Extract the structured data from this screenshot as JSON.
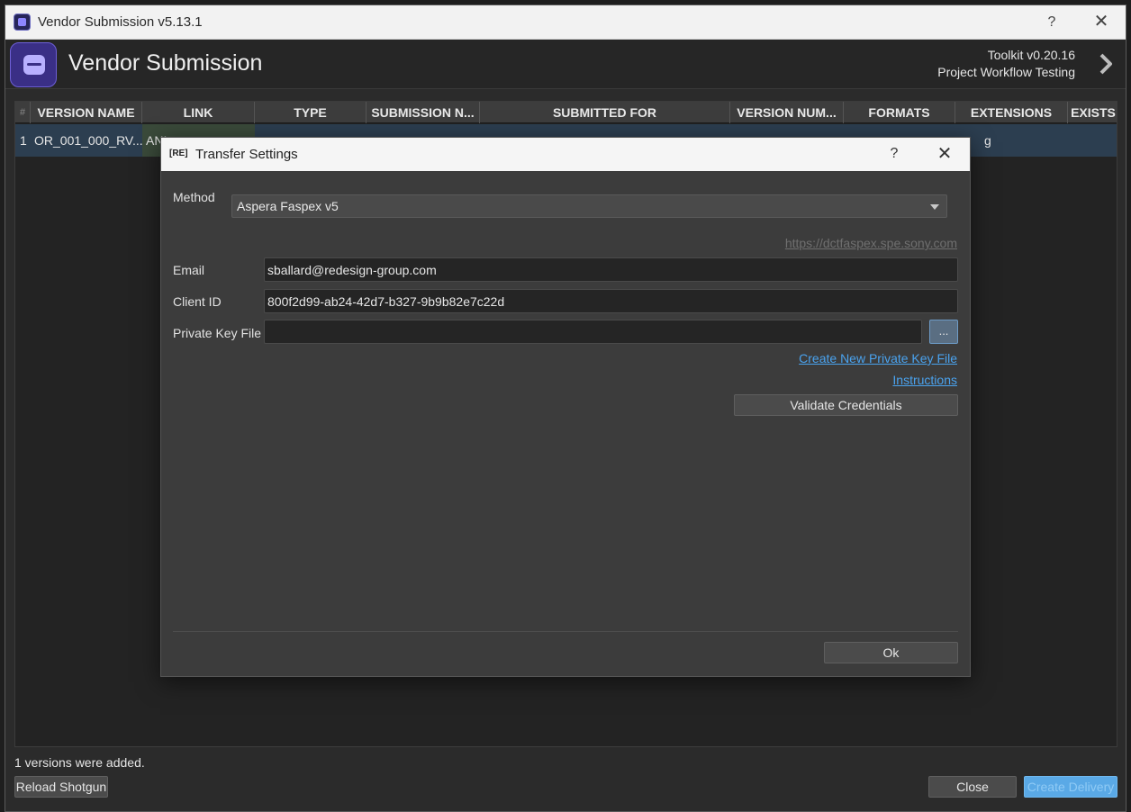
{
  "window": {
    "title": "Vendor Submission v5.13.1",
    "help_glyph": "?",
    "close_glyph": "✕"
  },
  "header": {
    "heading": "Vendor Submission",
    "toolkit_version": "Toolkit v0.20.16",
    "project": "Project Workflow Testing"
  },
  "table": {
    "columns": [
      "#",
      "VERSION NAME",
      "LINK",
      "TYPE",
      "SUBMISSION N...",
      "SUBMITTED FOR",
      "VERSION NUM...",
      "FORMATS",
      "EXTENSIONS",
      "EXISTS"
    ],
    "rows": [
      {
        "index": "1",
        "version_name": "OR_001_000_RV...",
        "link": "ANI",
        "type": "",
        "submission": "",
        "submitted_for": "",
        "version_number": "",
        "formats": "",
        "extensions": "g",
        "exists": ""
      }
    ]
  },
  "status": {
    "message": "1 versions were added."
  },
  "footer": {
    "reload_label": "Reload Shotgun",
    "close_label": "Close",
    "create_label": "Create Delivery"
  },
  "dialog": {
    "badge": "[RE]",
    "title": "Transfer Settings",
    "help_glyph": "?",
    "close_glyph": "✕",
    "method_label": "Method",
    "method_value": "Aspera Faspex v5",
    "server_url": "https://dctfaspex.spe.sony.com",
    "email_label": "Email",
    "email_value": "sballard@redesign-group.com",
    "client_id_label": "Client ID",
    "client_id_value": "800f2d99-ab24-42d7-b327-9b9b82e7c22d",
    "private_key_label": "Private Key File",
    "private_key_value": "",
    "browse_label": "...",
    "create_key_link": "Create New Private Key File",
    "instructions_link": "Instructions",
    "validate_label": "Validate Credentials",
    "ok_label": "Ok"
  }
}
